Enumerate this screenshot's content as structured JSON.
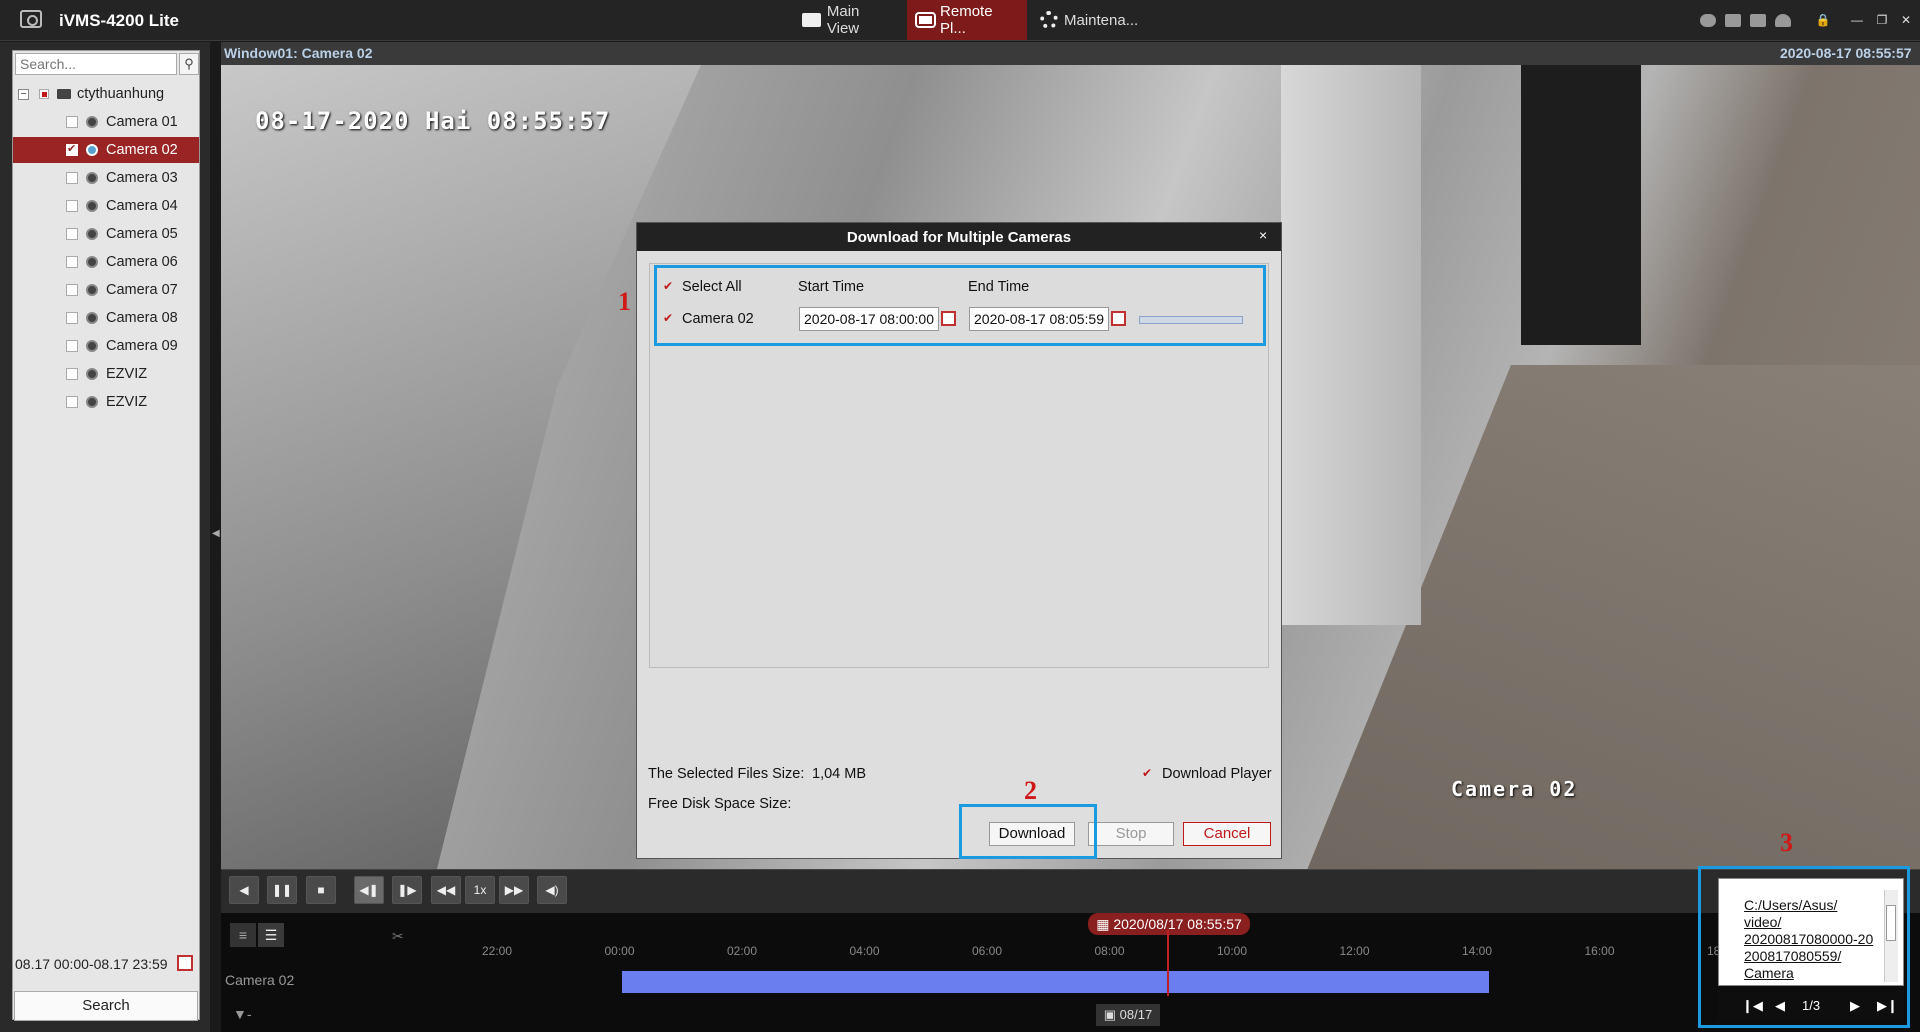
{
  "app": {
    "title": "iVMS-4200 Lite"
  },
  "nav": {
    "main_view": "Main View",
    "remote_playback": "Remote Pl...",
    "maintenance": "Maintena..."
  },
  "window_controls": {
    "lock": "🔒",
    "minimize": "—",
    "restore": "❐",
    "close": "✕"
  },
  "sidebar": {
    "search_placeholder": "Search...",
    "root": "ctythuanhung",
    "cameras": [
      "Camera 01",
      "Camera 02",
      "Camera 03",
      "Camera 04",
      "Camera 05",
      "Camera 06",
      "Camera 07",
      "Camera 08",
      "Camera 09",
      "EZVIZ",
      "EZVIZ"
    ],
    "selected_index": 1,
    "date_range": "08.17 00:00-08.17 23:59",
    "search_button": "Search"
  },
  "video": {
    "window_title": "Window01: Camera 02",
    "timestamp": "2020-08-17 08:55:57",
    "osd_time": "08-17-2020 Hai 08:55:57",
    "osd_camera": "Camera 02"
  },
  "controls": {
    "speed": "1x"
  },
  "timeline": {
    "current": "2020/08/17 08:55:57",
    "ticks": [
      "22:00",
      "00:00",
      "02:00",
      "04:00",
      "06:00",
      "08:00",
      "10:00",
      "12:00",
      "14:00",
      "16:00",
      "18"
    ],
    "camera_label": "Camera 02",
    "date": "08/17"
  },
  "dialog": {
    "title": "Download for Multiple Cameras",
    "select_all": "Select All",
    "start_time_header": "Start Time",
    "end_time_header": "End Time",
    "row_camera": "Camera 02",
    "start_time": "2020-08-17 08:00:00",
    "end_time": "2020-08-17 08:05:59",
    "files_size_label": "The Selected Files Size:",
    "files_size_value": "1,04 MB",
    "free_disk_label": "Free Disk Space Size:",
    "download_player": "Download Player",
    "download_button": "Download",
    "stop_button": "Stop",
    "cancel_button": "Cancel"
  },
  "annotations": {
    "one": "1",
    "two": "2",
    "three": "3"
  },
  "tooltip": {
    "path": "C:/Users/Asus/\nvideo/\n20200817080000-20\n200817080559/\nCamera",
    "page": "1/3"
  },
  "colors": {
    "accent": "#7d1b1b",
    "highlight": "#1a9ae0",
    "timeline_bar": "#6a7ef0"
  }
}
